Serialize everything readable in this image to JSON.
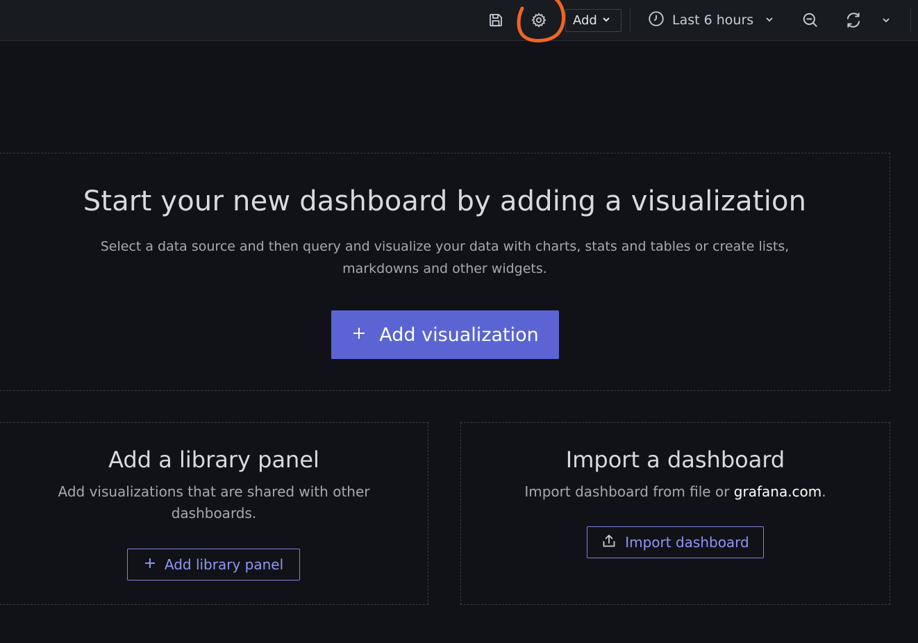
{
  "toolbar": {
    "save_icon": "save-icon",
    "settings_icon": "gear-icon",
    "add_label": "Add",
    "time_range_label": "Last 6 hours",
    "zoom_icon": "zoom-out-icon",
    "refresh_icon": "refresh-icon"
  },
  "annotation_color": "#f26522",
  "main": {
    "title": "Start your new dashboard by adding a visualization",
    "description": "Select a data source and then query and visualize your data with charts, stats and tables or create lists, markdowns and other widgets.",
    "button_label": "Add visualization"
  },
  "library": {
    "title": "Add a library panel",
    "description": "Add visualizations that are shared with other dashboards.",
    "button_label": "Add library panel"
  },
  "import": {
    "title": "Import a dashboard",
    "description_prefix": "Import dashboard from file or ",
    "link_text": "grafana.com",
    "description_suffix": ".",
    "button_label": "Import dashboard"
  },
  "colors": {
    "primary": "#5b64d3",
    "secondary_text": "#8f96f5",
    "background": "#111217"
  }
}
